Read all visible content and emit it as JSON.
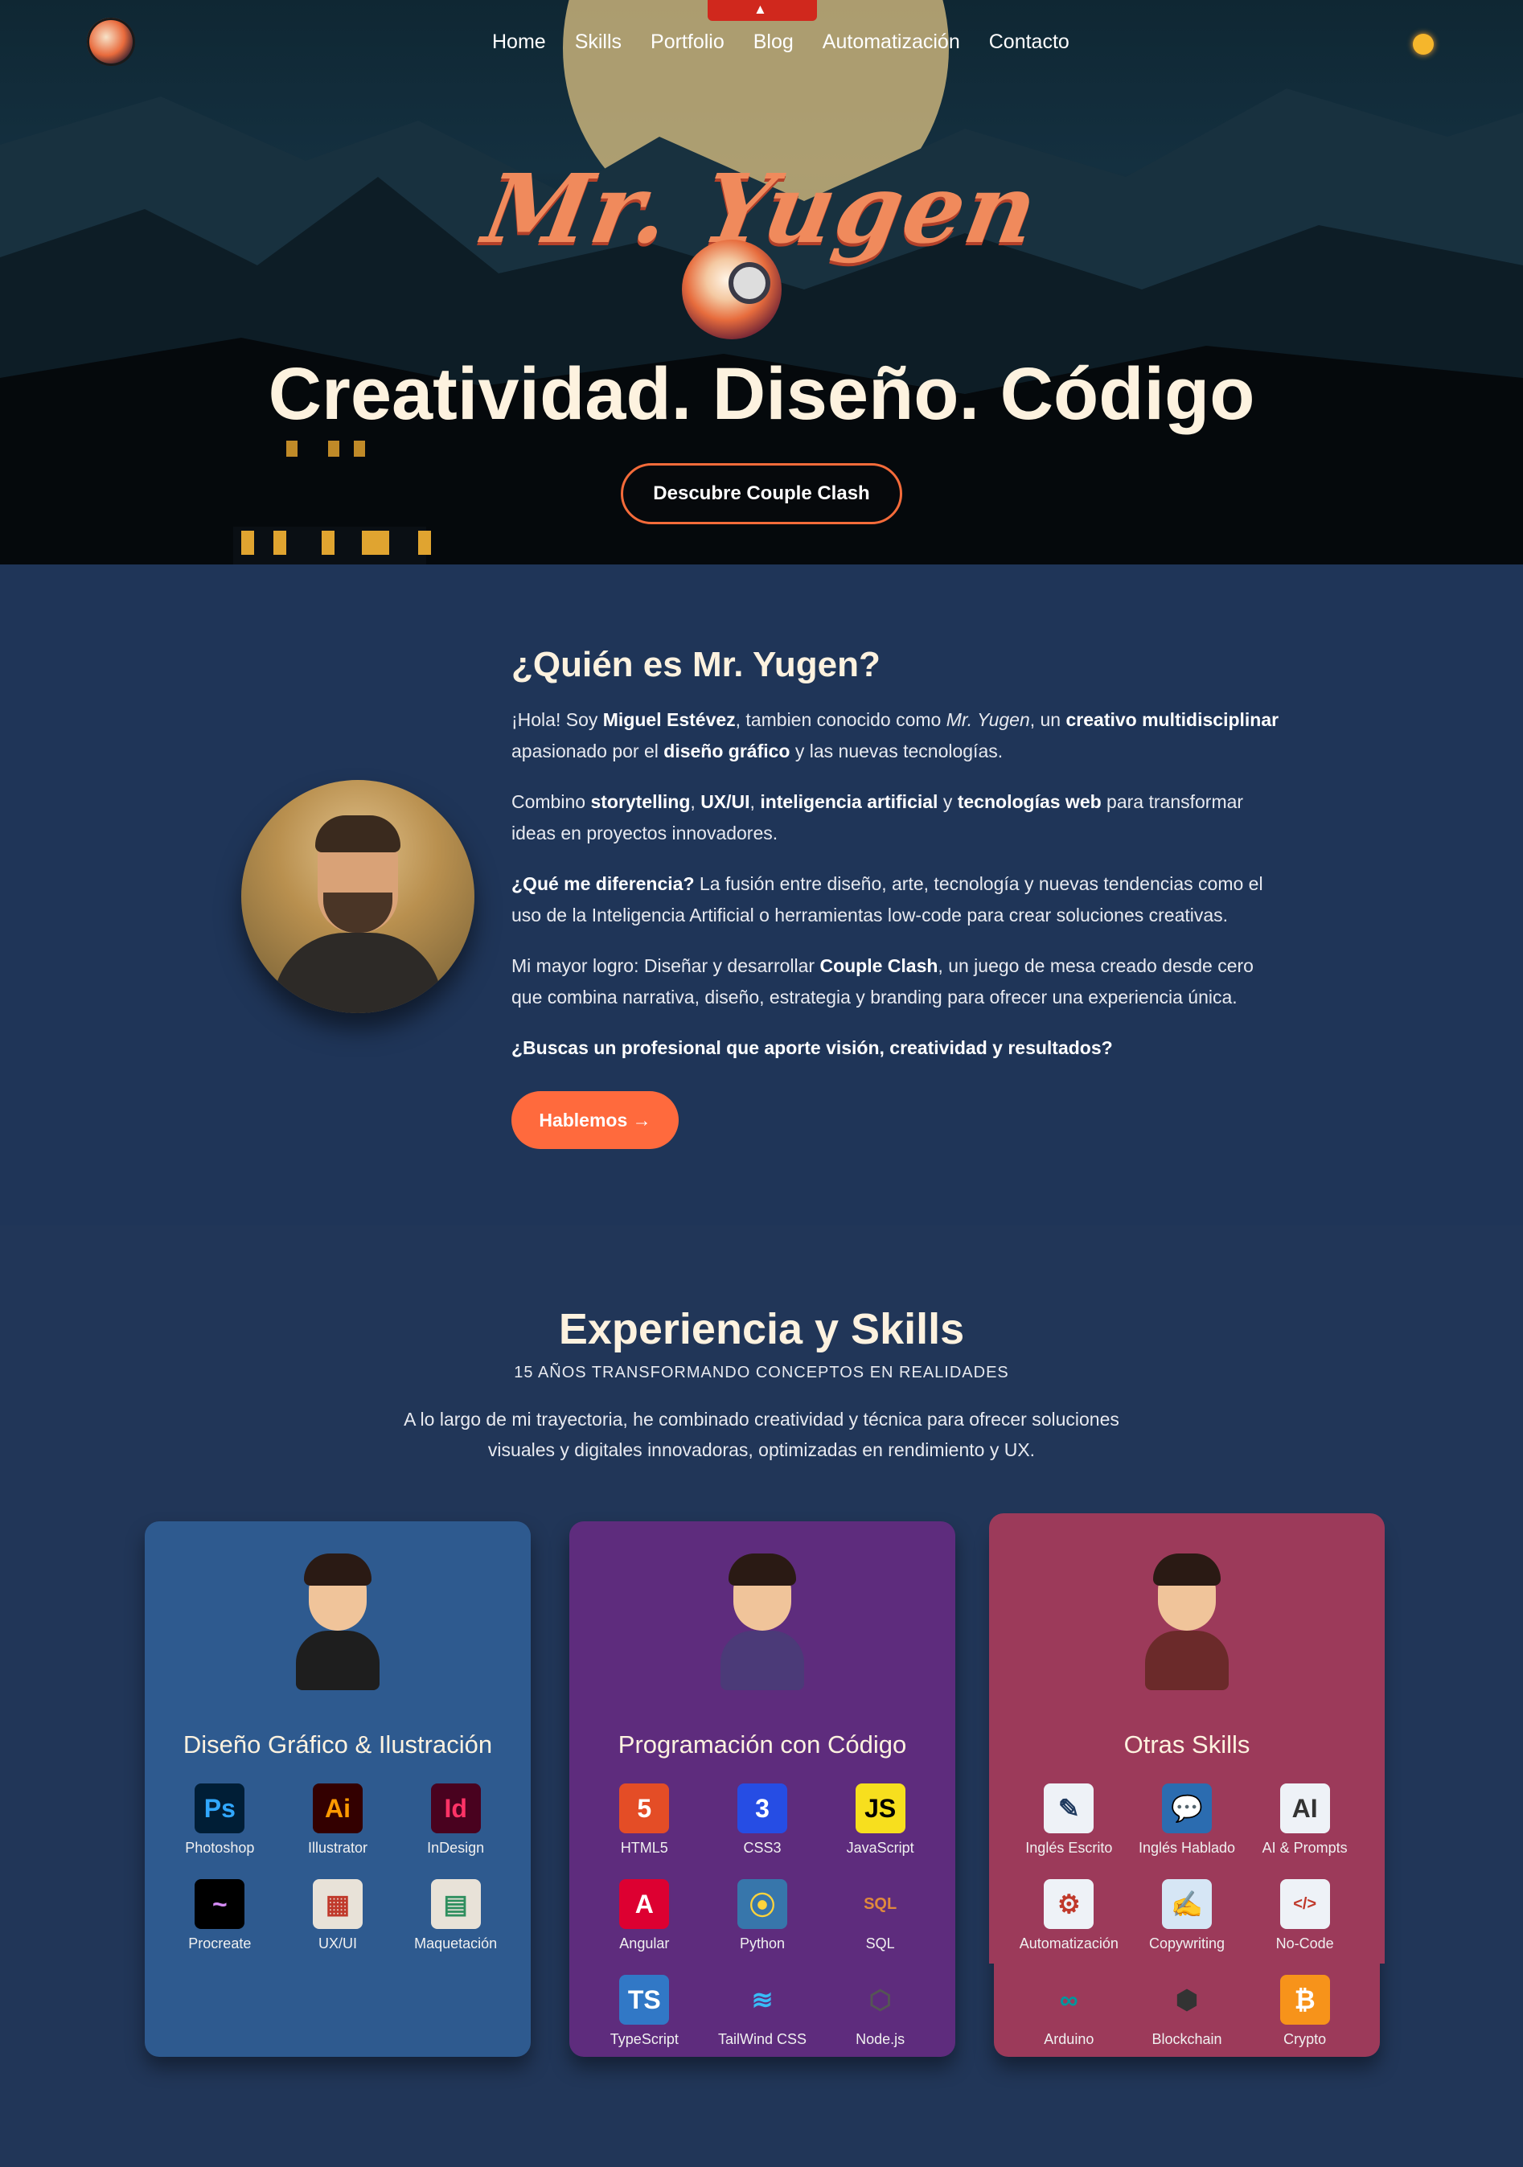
{
  "nav": {
    "links": [
      "Home",
      "Skills",
      "Portfolio",
      "Blog",
      "Automatización",
      "Contacto"
    ]
  },
  "hero": {
    "script_title": "Mr. Yugen",
    "headline": "Creatividad. Diseño. Código",
    "cta": "Descubre Couple Clash"
  },
  "about": {
    "title": "¿Quién es Mr. Yugen?",
    "cta": "Hablemos →"
  },
  "skills": {
    "title": "Experiencia y Skills",
    "subtitle": "15 AÑOS TRANSFORMANDO CONCEPTOS EN REALIDADES",
    "description": "A lo largo de mi trayectoria, he combinado creatividad y técnica para ofrecer soluciones visuales y digitales innovadoras, optimizadas en rendimiento y UX.",
    "cards": [
      {
        "title": "Diseño Gráfico & Ilustración",
        "items": [
          {
            "label": "Photoshop",
            "glyph": "Ps",
            "icon": "photoshop-icon",
            "bg": "#001e36",
            "fg": "#31a8ff"
          },
          {
            "label": "Illustrator",
            "glyph": "Ai",
            "icon": "illustrator-icon",
            "bg": "#330000",
            "fg": "#ff9a00"
          },
          {
            "label": "InDesign",
            "glyph": "Id",
            "icon": "indesign-icon",
            "bg": "#49021f",
            "fg": "#ff3366"
          },
          {
            "label": "Procreate",
            "glyph": "~",
            "icon": "procreate-icon",
            "bg": "#000000",
            "fg": "#d58bf5"
          },
          {
            "label": "UX/UI",
            "glyph": "▦",
            "icon": "ux-ui-icon",
            "bg": "#e8e2d8",
            "fg": "#c0392b"
          },
          {
            "label": "Maquetación",
            "glyph": "▤",
            "icon": "layout-icon",
            "bg": "#e8e2d8",
            "fg": "#2f8f5f"
          }
        ]
      },
      {
        "title": "Programación con Código",
        "items": [
          {
            "label": "HTML5",
            "glyph": "5",
            "icon": "html5-icon",
            "bg": "#e44d26",
            "fg": "#ffffff"
          },
          {
            "label": "CSS3",
            "glyph": "3",
            "icon": "css3-icon",
            "bg": "#264de4",
            "fg": "#ffffff"
          },
          {
            "label": "JavaScript",
            "glyph": "JS",
            "icon": "javascript-icon",
            "bg": "#f7df1e",
            "fg": "#000000"
          },
          {
            "label": "Angular",
            "glyph": "A",
            "icon": "angular-icon",
            "bg": "#dd0031",
            "fg": "#ffffff"
          },
          {
            "label": "Python",
            "glyph": "⦿",
            "icon": "python-icon",
            "bg": "#3776ab",
            "fg": "#ffd43b"
          },
          {
            "label": "SQL",
            "glyph": "SQL",
            "icon": "sql-icon",
            "bg": "transparent",
            "fg": "#e08a3c"
          },
          {
            "label": "TypeScript",
            "glyph": "TS",
            "icon": "typescript-icon",
            "bg": "#3178c6",
            "fg": "#ffffff"
          },
          {
            "label": "TailWind CSS",
            "glyph": "≋",
            "icon": "tailwind-icon",
            "bg": "transparent",
            "fg": "#38bdf8"
          },
          {
            "label": "Node.js",
            "glyph": "⬡",
            "icon": "nodejs-icon",
            "bg": "transparent",
            "fg": "#555555"
          }
        ]
      },
      {
        "title": "Otras Skills",
        "items": [
          {
            "label": "Inglés Escrito",
            "glyph": "✎",
            "icon": "english-written-icon",
            "bg": "#eef2f7",
            "fg": "#1f3a5f"
          },
          {
            "label": "Inglés Hablado",
            "glyph": "💬",
            "icon": "english-spoken-icon",
            "bg": "#2b6cb0",
            "fg": "#ffffff"
          },
          {
            "label": "AI & Prompts",
            "glyph": "AI",
            "icon": "ai-prompts-icon",
            "bg": "#eef2f7",
            "fg": "#333333"
          },
          {
            "label": "Automatización",
            "glyph": "⚙",
            "icon": "automation-icon",
            "bg": "#eef2f7",
            "fg": "#c0392b"
          },
          {
            "label": "Copywriting",
            "glyph": "✍",
            "icon": "copywriting-icon",
            "bg": "#d6e6f5",
            "fg": "#2b6cb0"
          },
          {
            "label": "No-Code",
            "glyph": "</>",
            "icon": "no-code-icon",
            "bg": "#eef2f7",
            "fg": "#c0392b"
          },
          {
            "label": "Arduino",
            "glyph": "∞",
            "icon": "arduino-icon",
            "bg": "transparent",
            "fg": "#00979d"
          },
          {
            "label": "Blockchain",
            "glyph": "⬢",
            "icon": "blockchain-icon",
            "bg": "transparent",
            "fg": "#333333"
          },
          {
            "label": "Crypto",
            "glyph": "₿",
            "icon": "crypto-icon",
            "bg": "#f7931a",
            "fg": "#ffffff"
          }
        ]
      }
    ]
  }
}
